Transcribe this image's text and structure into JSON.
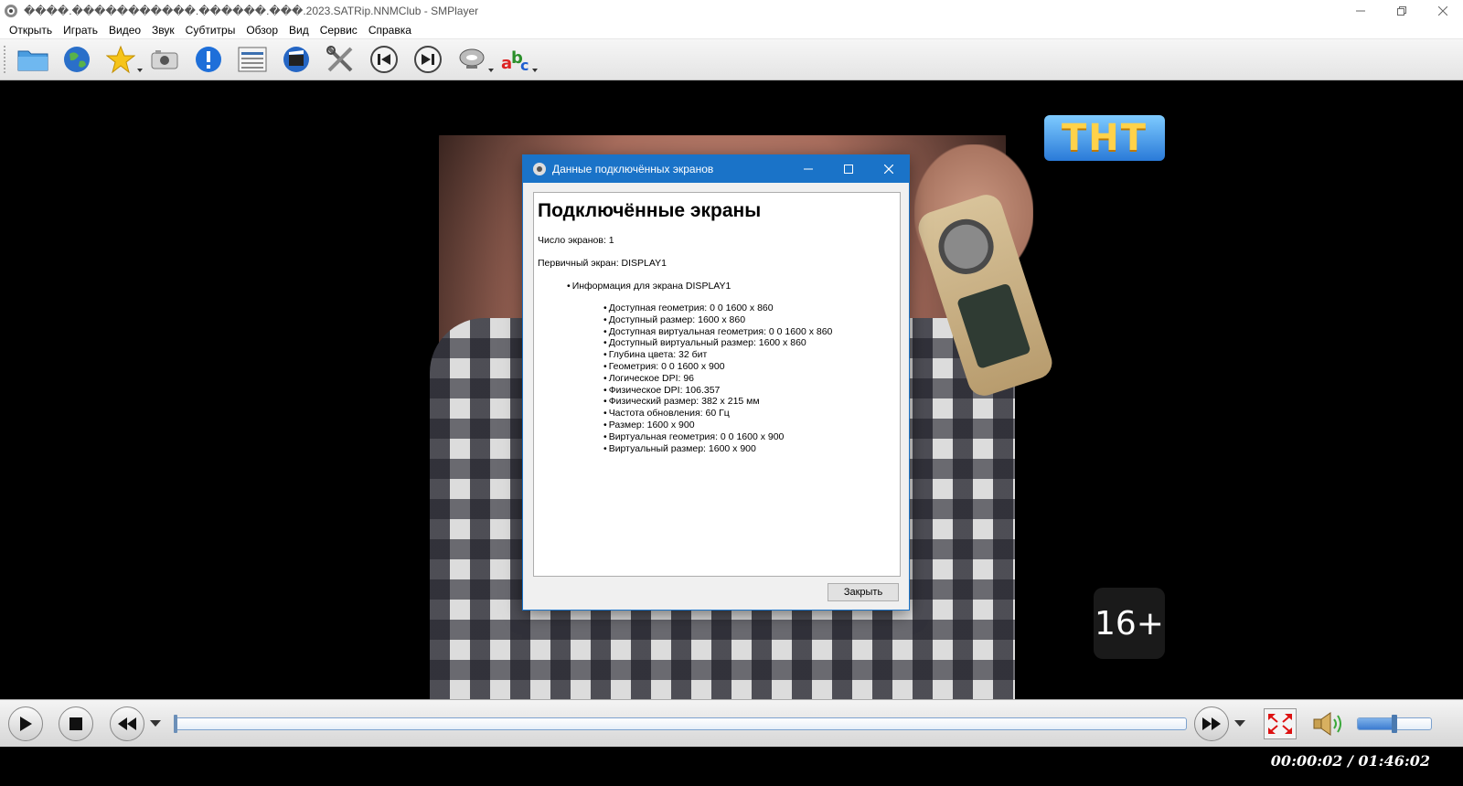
{
  "window": {
    "title": "����.�����������.������.���.2023.SATRip.NNMClub - SMPlayer",
    "min_icon": "minimize-icon",
    "restore_icon": "restore-icon",
    "close_icon": "close-icon"
  },
  "menu": {
    "items": [
      "Открыть",
      "Играть",
      "Видео",
      "Звук",
      "Субтитры",
      "Обзор",
      "Вид",
      "Сервис",
      "Справка"
    ]
  },
  "toolbar": {
    "icons": [
      "open-folder-icon",
      "open-url-globe-icon",
      "favorites-star-icon",
      "screenshot-camera-icon",
      "info-icon",
      "playlist-icon",
      "video-clapper-icon",
      "preferences-tools-icon",
      "previous-track-icon",
      "next-track-icon",
      "audio-track-icon",
      "subtitles-abc-icon"
    ]
  },
  "video": {
    "channel_logo": "ТНТ",
    "age_rating": "16+"
  },
  "dialog": {
    "title": "Данные подключённых экранов",
    "heading": "Подключённые экраны",
    "screen_count": "Число экранов: 1",
    "primary_screen": "Первичный экран: DISPLAY1",
    "info_header": "Информация для экрана DISPLAY1",
    "details": [
      "Доступная геометрия: 0 0 1600 x 860",
      "Доступный размер: 1600 x 860",
      "Доступная виртуальная геометрия: 0 0 1600 x 860",
      "Доступный виртуальный размер: 1600 x 860",
      "Глубина цвета: 32 бит",
      "Геометрия: 0 0 1600 x 900",
      "Логическое DPI: 96",
      "Физическое DPI: 106.357",
      "Физический размер: 382 x 215 мм",
      "Частота обновления: 60 Гц",
      "Размер: 1600 x 900",
      "Виртуальная геометрия: 0 0 1600 x 900",
      "Виртуальный размер: 1600 x 900"
    ],
    "close_label": "Закрыть"
  },
  "player": {
    "seek_position": 0.0002,
    "volume_level": 0.5,
    "time_display": "00:00:02 / 01:46:02"
  },
  "colors": {
    "dialog_title_bg": "#1a73c8",
    "video_bg": "#000000",
    "accent_blue": "#3c7cd0"
  }
}
